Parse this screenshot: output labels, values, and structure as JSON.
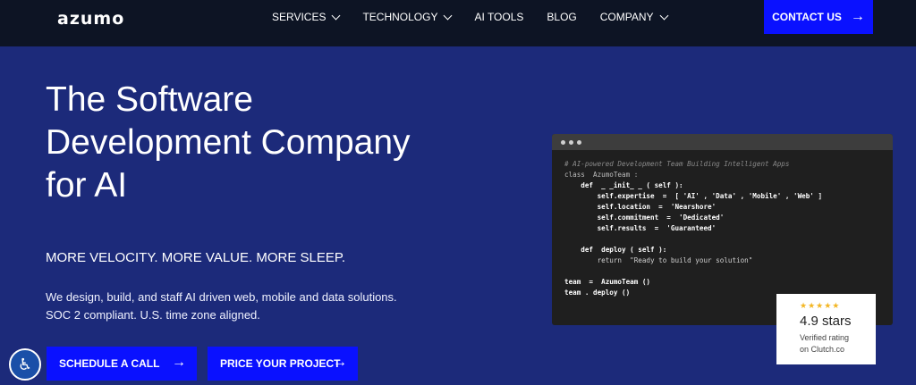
{
  "nav": {
    "logo": "azumo",
    "items": [
      {
        "label": "SERVICES",
        "dropdown": true
      },
      {
        "label": "TECHNOLOGY",
        "dropdown": true
      },
      {
        "label": "AI TOOLS",
        "dropdown": false
      },
      {
        "label": "BLOG",
        "dropdown": false
      },
      {
        "label": "COMPANY",
        "dropdown": true
      }
    ],
    "contact_label": "CONTACT US"
  },
  "hero": {
    "title_lines": [
      "The Software",
      "Development Company",
      "for AI"
    ],
    "tagline": "MORE VELOCITY. MORE VALUE. MORE SLEEP.",
    "desc_lines": [
      "We design, build, and staff AI driven web, mobile and data solutions.",
      "SOC 2 compliant. U.S. time zone aligned."
    ],
    "cta_primary": "SCHEDULE A CALL",
    "cta_secondary": "PRICE YOUR PROJECT"
  },
  "code": {
    "comment": "# AI-powered Development Team Building Intelligent Apps",
    "class_line": "class  AzumoTeam :",
    "init_line": "    def  _ _init_ _ ( self ):",
    "expertise": "        self.expertise  =  [ 'AI' , 'Data' , 'Mobile' , 'Web' ]",
    "location": "        self.location  =  'Nearshore'",
    "commitment": "        self.commitment  =  'Dedicated'",
    "results": "        self.results  =  'Guaranteed'",
    "deploy_def": "    def  deploy ( self ):",
    "return_line": "        return  \"Ready to build your solution\"",
    "team_line": "team  =  AzumoTeam ()",
    "deploy_call": "team . deploy ()"
  },
  "rating": {
    "stars": "★★★★★",
    "score": "4.9 stars",
    "verified_1": "Verified rating",
    "verified_2": "on Clutch.co"
  },
  "colors": {
    "nav_bg": "#0d1424",
    "hero_bg": "#1c2a7a",
    "accent": "#0a11ff",
    "star": "#f3b623"
  },
  "icons": {
    "arrow": "arrow-right-icon",
    "chevron": "chevron-down-icon",
    "accessibility": "accessibility-icon"
  }
}
